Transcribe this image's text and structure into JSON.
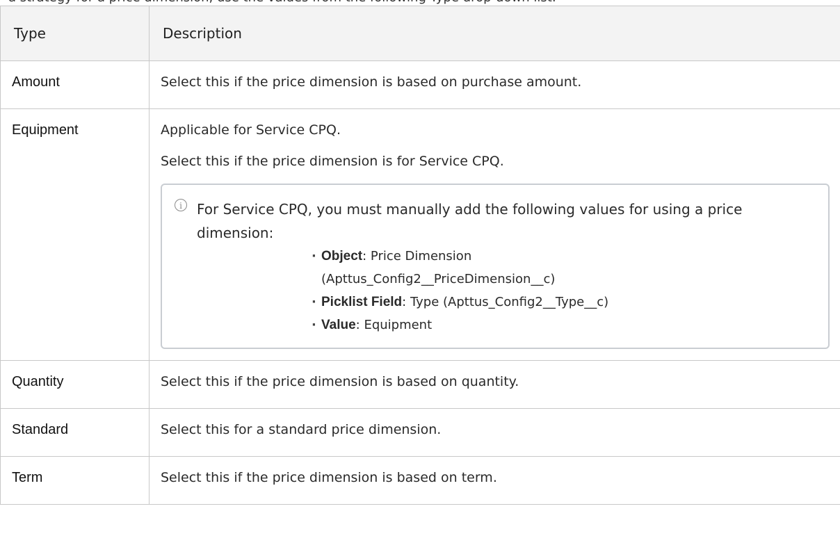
{
  "intro_fragment": "a strategy for a price dimension, use the values from the following Type drop-down list:",
  "table": {
    "headers": [
      "Type",
      "Description"
    ],
    "rows": [
      {
        "type": "Amount",
        "description": "Select this if the price dimension is based on purchase amount."
      },
      {
        "type": "Equipment",
        "line1": "Applicable for Service CPQ.",
        "line2": "Select this if the price dimension is for Service CPQ.",
        "note": {
          "icon": "info-icon",
          "text": "For Service CPQ, you must manually add the following values for using a price dimension:",
          "items": [
            {
              "key": "Object",
              "value": ": Price Dimension",
              "value_cont": "(Apttus_Config2__PriceDimension__c)"
            },
            {
              "key": "Picklist Field",
              "value": ": Type (Apttus_Config2__Type__c)"
            },
            {
              "key": "Value",
              "value": ": Equipment"
            }
          ]
        }
      },
      {
        "type": "Quantity",
        "description": "Select this if the price dimension is based on quantity."
      },
      {
        "type": "Standard",
        "description": "Select this for a standard price dimension."
      },
      {
        "type": "Term",
        "description": "Select this if the price dimension is based on term."
      }
    ]
  }
}
